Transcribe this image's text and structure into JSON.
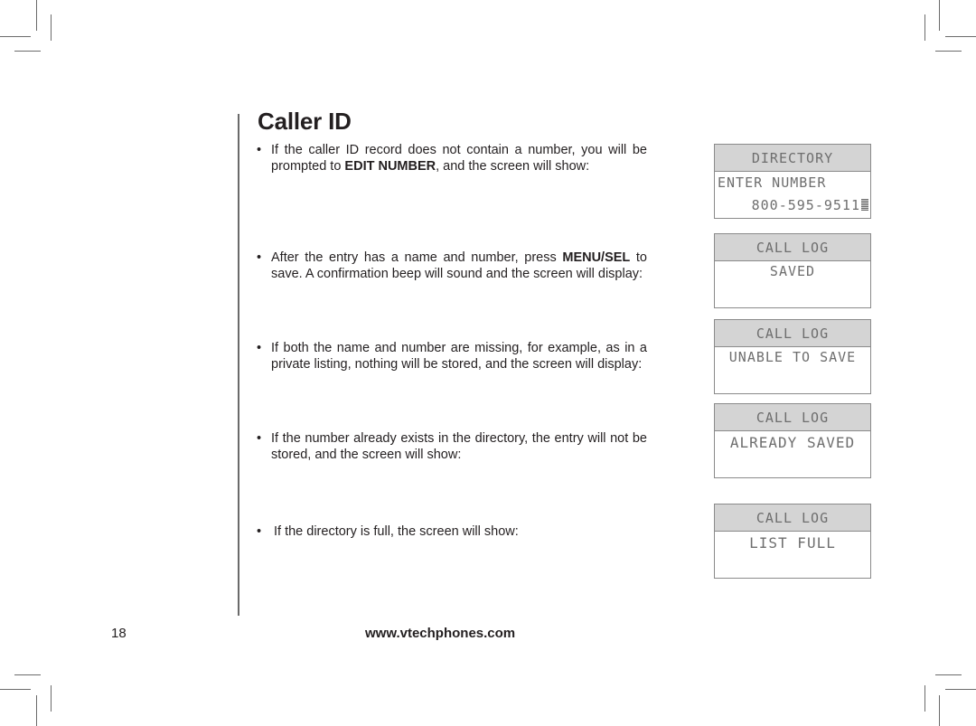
{
  "page": {
    "title": "Caller ID",
    "page_number": "18",
    "footer_url": "www.vtechphones.com"
  },
  "bullets": [
    {
      "marker": "•",
      "before": "If the caller ID record does not contain a number, you will be prompted to ",
      "bold": "EDIT NUMBER",
      "after": ", and the screen will show:"
    },
    {
      "marker": "•",
      "before": "After the entry has a name and number, press ",
      "bold": "MENU/SEL",
      "after": " to save. A confirmation beep will sound and the screen will display:"
    },
    {
      "marker": "•",
      "before": "If both the name and number are missing, for example, as in a private listing, nothing will be stored, and the screen will display:",
      "bold": "",
      "after": ""
    },
    {
      "marker": "•",
      "before": "If the number already exists in the directory, the entry will not be stored, and the screen will show:",
      "bold": "",
      "after": ""
    },
    {
      "marker": "•",
      "before": "If the directory is full, the screen will show:",
      "bold": "",
      "after": ""
    }
  ],
  "screens": [
    {
      "header": "DIRECTORY",
      "line1": "ENTER NUMBER",
      "line2": "800-595-9511",
      "cursor_icon": "block-cursor"
    },
    {
      "header": "CALL LOG",
      "line1": "SAVED"
    },
    {
      "header": "CALL LOG",
      "line1": "UNABLE TO SAVE"
    },
    {
      "header": "CALL LOG",
      "line1": "ALREADY SAVED"
    },
    {
      "header": "CALL LOG",
      "line1": "LIST FULL"
    }
  ]
}
